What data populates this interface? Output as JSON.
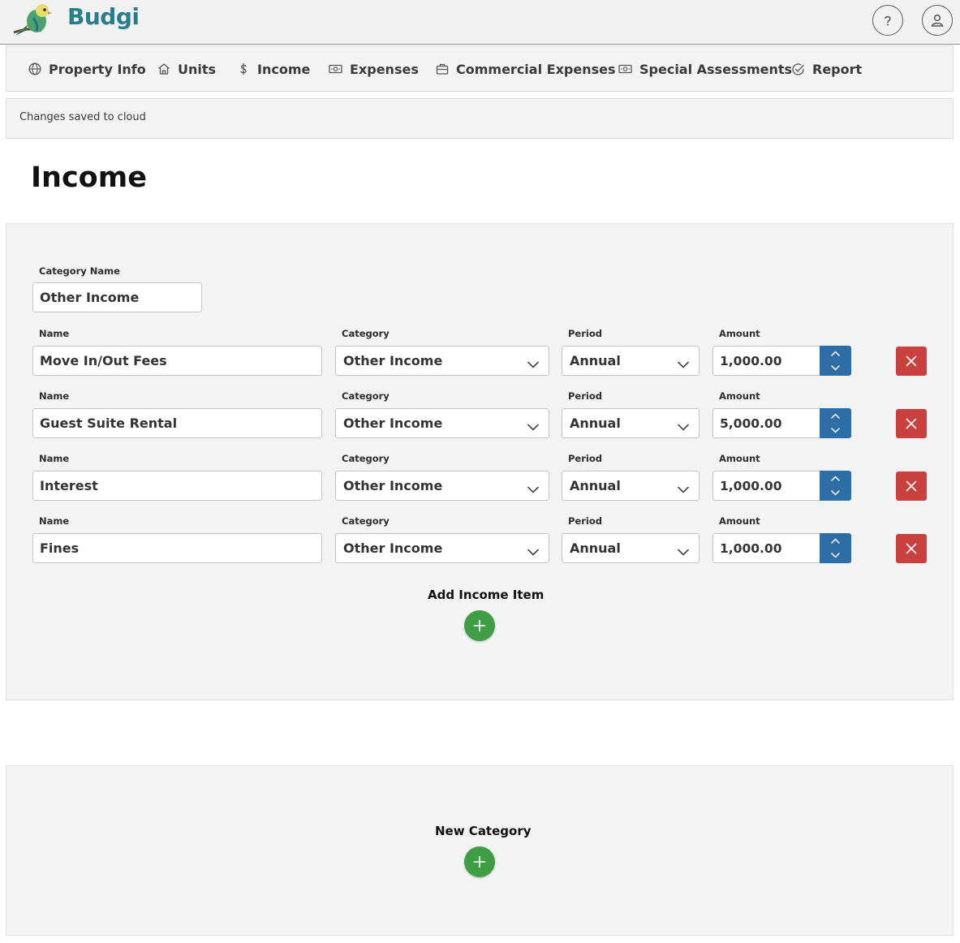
{
  "app": {
    "name": "Budgi",
    "icons": {
      "help": "help-circle-icon",
      "user": "user-icon"
    }
  },
  "nav": [
    {
      "label": "Property Info",
      "icon": "globe-icon"
    },
    {
      "label": "Units",
      "icon": "home-icon"
    },
    {
      "label": "Income",
      "icon": "dollar-icon"
    },
    {
      "label": "Expenses",
      "icon": "money-icon"
    },
    {
      "label": "Commercial Expenses",
      "icon": "briefcase-icon"
    },
    {
      "label": "Special Assessments",
      "icon": "money-icon"
    },
    {
      "label": "Report",
      "icon": "check-circle-icon"
    }
  ],
  "status": "Changes saved to cloud",
  "page_title": "Income",
  "category": {
    "label": "Category Name",
    "value": "Other Income"
  },
  "labels": {
    "name": "Name",
    "category": "Category",
    "period": "Period",
    "amount": "Amount"
  },
  "items": [
    {
      "name": "Move In/Out Fees",
      "category": "Other Income",
      "period": "Annual",
      "amount": "1,000.00"
    },
    {
      "name": "Guest Suite Rental",
      "category": "Other Income",
      "period": "Annual",
      "amount": "5,000.00"
    },
    {
      "name": "Interest",
      "category": "Other Income",
      "period": "Annual",
      "amount": "1,000.00"
    },
    {
      "name": "Fines",
      "category": "Other Income",
      "period": "Annual",
      "amount": "1,000.00"
    }
  ],
  "add_item_label": "Add Income Item",
  "new_category_label": "New Category",
  "colors": {
    "stepper": "#2d6ea6",
    "delete": "#c9413e",
    "add": "#3e9d45",
    "logo": "#2a7d8c"
  }
}
